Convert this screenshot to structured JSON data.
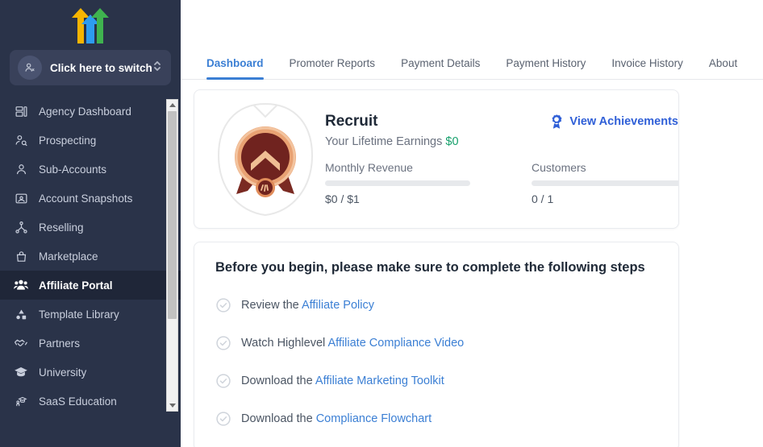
{
  "sidebar": {
    "logo": {
      "icon": "three-arrows-logo"
    },
    "switcher": {
      "label": "Click here to switch",
      "avatar_icon": "account-avatar-icon",
      "caret_icon": "chevron-up-down-icon"
    },
    "items": [
      {
        "label": "Agency Dashboard",
        "icon": "dashboard-icon",
        "active": false
      },
      {
        "label": "Prospecting",
        "icon": "person-search-icon",
        "active": false
      },
      {
        "label": "Sub-Accounts",
        "icon": "person-icon",
        "active": false
      },
      {
        "label": "Account Snapshots",
        "icon": "snapshot-icon",
        "active": false
      },
      {
        "label": "Reselling",
        "icon": "network-icon",
        "active": false
      },
      {
        "label": "Marketplace",
        "icon": "bag-icon",
        "active": false
      },
      {
        "label": "Affiliate Portal",
        "icon": "people-group-icon",
        "active": true
      },
      {
        "label": "Template Library",
        "icon": "shapes-icon",
        "active": false
      },
      {
        "label": "Partners",
        "icon": "handshake-icon",
        "active": false
      },
      {
        "label": "University",
        "icon": "graduation-cap-icon",
        "active": false
      },
      {
        "label": "SaaS Education",
        "icon": "person-graduate-icon",
        "active": false
      }
    ]
  },
  "tabs": [
    {
      "label": "Dashboard",
      "active": true
    },
    {
      "label": "Promoter Reports",
      "active": false
    },
    {
      "label": "Payment Details",
      "active": false
    },
    {
      "label": "Payment History",
      "active": false
    },
    {
      "label": "Invoice History",
      "active": false
    },
    {
      "label": "About",
      "active": false
    }
  ],
  "rank_card": {
    "badge_icon": "recruit-rank-badge",
    "title": "Recruit",
    "lifetime_label": "Your Lifetime Earnings ",
    "lifetime_value": "$0",
    "achievements_label": "View Achievements",
    "achievements_icon": "ribbon-award-icon",
    "stats": [
      {
        "label": "Monthly Revenue",
        "value": "$0 / $1",
        "progress": 0
      },
      {
        "label": "Customers",
        "value": "0 / 1",
        "progress": 0
      }
    ]
  },
  "steps_card": {
    "title": "Before you begin, please make sure to complete the following steps",
    "steps": [
      {
        "icon": "check-circle-icon",
        "prefix": "Review the ",
        "link": "Affiliate Policy"
      },
      {
        "icon": "check-circle-icon",
        "prefix": "Watch Highlevel ",
        "link": "Affiliate Compliance Video"
      },
      {
        "icon": "check-circle-icon",
        "prefix": "Download the ",
        "link": "Affiliate Marketing Toolkit"
      },
      {
        "icon": "check-circle-icon",
        "prefix": "Download the ",
        "link": "Compliance Flowchart"
      }
    ]
  },
  "colors": {
    "sidebar_bg": "#2a3349",
    "sidebar_active": "#1f2638",
    "accent_blue": "#3b7fd4",
    "link_blue": "#2f5fd7",
    "money_green": "#16a06c",
    "badge_bronze": "#e08c5a",
    "badge_dark": "#70231f"
  }
}
